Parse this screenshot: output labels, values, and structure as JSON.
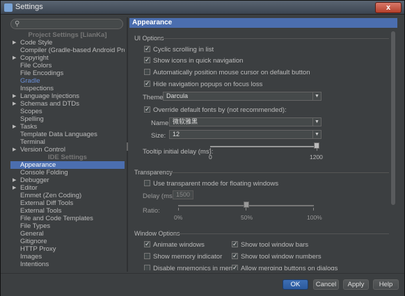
{
  "window": {
    "title": "Settings",
    "close_label": "x"
  },
  "search": {
    "placeholder": ""
  },
  "tree": {
    "project_header": "Project Settings [LianKa]",
    "project_items": [
      {
        "label": "Code Style",
        "arrow": true
      },
      {
        "label": "Compiler (Gradle-based Android Proje...",
        "arrow": false
      },
      {
        "label": "Copyright",
        "arrow": true
      },
      {
        "label": "File Colors",
        "arrow": false
      },
      {
        "label": "File Encodings",
        "arrow": false
      },
      {
        "label": "Gradle",
        "arrow": false
      },
      {
        "label": "Inspections",
        "arrow": false
      },
      {
        "label": "Language Injections",
        "arrow": true
      },
      {
        "label": "Schemas and DTDs",
        "arrow": true
      },
      {
        "label": "Scopes",
        "arrow": false
      },
      {
        "label": "Spelling",
        "arrow": false
      },
      {
        "label": "Tasks",
        "arrow": true
      },
      {
        "label": "Template Data Languages",
        "arrow": false
      },
      {
        "label": "Terminal",
        "arrow": false
      },
      {
        "label": "Version Control",
        "arrow": true
      }
    ],
    "ide_header": "IDE Settings",
    "ide_items": [
      {
        "label": "Appearance",
        "arrow": false
      },
      {
        "label": "Console Folding",
        "arrow": false
      },
      {
        "label": "Debugger",
        "arrow": true
      },
      {
        "label": "Editor",
        "arrow": true
      },
      {
        "label": "Emmet (Zen Coding)",
        "arrow": false
      },
      {
        "label": "External Diff Tools",
        "arrow": false
      },
      {
        "label": "External Tools",
        "arrow": false
      },
      {
        "label": "File and Code Templates",
        "arrow": false
      },
      {
        "label": "File Types",
        "arrow": false
      },
      {
        "label": "General",
        "arrow": false
      },
      {
        "label": "Gitignore",
        "arrow": false
      },
      {
        "label": "HTTP Proxy",
        "arrow": false
      },
      {
        "label": "Images",
        "arrow": false
      },
      {
        "label": "Intentions",
        "arrow": false
      }
    ]
  },
  "panel": {
    "title": "Appearance",
    "ui_options": {
      "title": "UI Options",
      "cyclic_scrolling": {
        "label": "Cyclic scrolling in list",
        "checked": true
      },
      "show_icons": {
        "label": "Show icons in quick navigation",
        "checked": true
      },
      "auto_position": {
        "label": "Automatically position mouse cursor on default button",
        "checked": false
      },
      "hide_nav_popups": {
        "label": "Hide navigation popups on focus loss",
        "checked": true
      },
      "theme_label": "Theme:",
      "theme_value": "Darcula",
      "override_fonts": {
        "label": "Override default fonts by (not recommended):",
        "checked": true
      },
      "name_label": "Name:",
      "name_value": "微软雅黑",
      "size_label": "Size:",
      "size_value": "12",
      "tooltip_label": "Tooltip initial delay (ms):",
      "tooltip_min": "0",
      "tooltip_max": "1200",
      "tooltip_value_fraction": 1.0
    },
    "transparency": {
      "title": "Transparency",
      "use_transparent": {
        "label": "Use transparent mode for floating windows",
        "checked": false
      },
      "delay_label": "Delay (ms):",
      "delay_value": "1500",
      "ratio_label": "Ratio:",
      "ratio_ticks": [
        "0%",
        "50%",
        "100%"
      ],
      "ratio_value_fraction": 0.5
    },
    "window_options": {
      "title": "Window Options",
      "animate_windows": {
        "label": "Animate windows",
        "checked": true
      },
      "show_tool_bars": {
        "label": "Show tool window bars",
        "checked": true
      },
      "show_memory": {
        "label": "Show memory indicator",
        "checked": false
      },
      "show_tool_numbers": {
        "label": "Show tool window numbers",
        "checked": true
      },
      "disable_mnemonics": {
        "label": "Disable mnemonics in menu",
        "checked": false
      },
      "allow_merging": {
        "label": "Allow merging buttons on dialogs",
        "checked": true
      }
    }
  },
  "buttons": {
    "ok": "OK",
    "cancel": "Cancel",
    "apply": "Apply",
    "help": "Help"
  }
}
